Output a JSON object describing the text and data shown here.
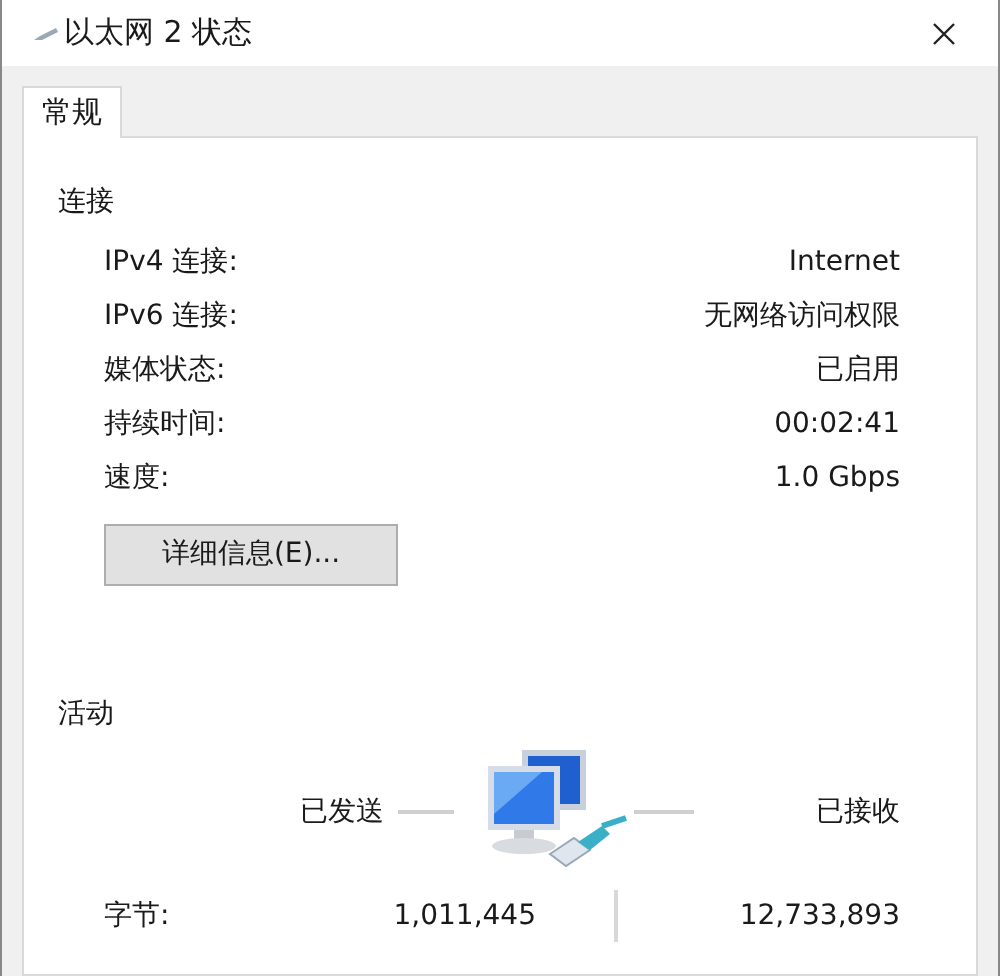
{
  "window": {
    "title": "以太网 2 状态"
  },
  "tabs": [
    {
      "label": "常规",
      "selected": true
    }
  ],
  "connection": {
    "heading": "连接",
    "rows": [
      {
        "label": "IPv4 连接:",
        "value": "Internet"
      },
      {
        "label": "IPv6 连接:",
        "value": "无网络访问权限"
      },
      {
        "label": "媒体状态:",
        "value": "已启用"
      },
      {
        "label": "持续时间:",
        "value": "00:02:41"
      },
      {
        "label": "速度:",
        "value": "1.0 Gbps"
      }
    ],
    "button": "详细信息(E)..."
  },
  "activity": {
    "heading": "活动",
    "sent_label": "已发送",
    "received_label": "已接收",
    "rows": [
      {
        "label": "字节:",
        "sent": "1,011,445",
        "received": "12,733,893"
      }
    ]
  }
}
